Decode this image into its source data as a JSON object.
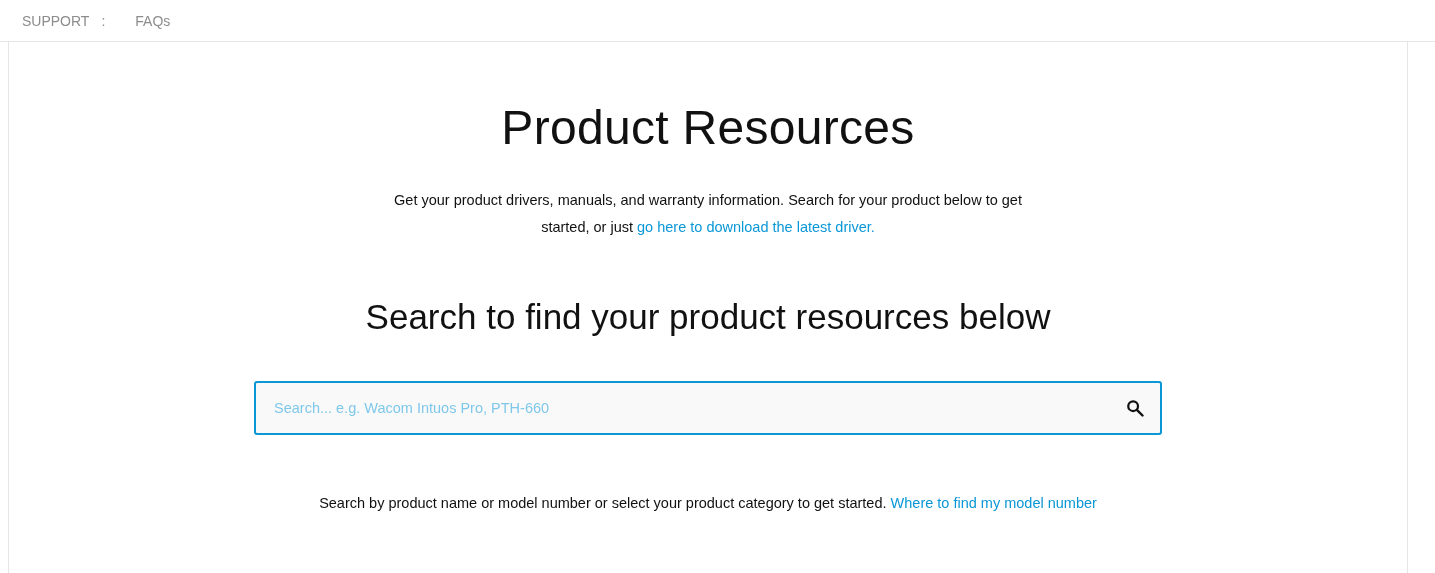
{
  "breadcrumb": [
    {
      "label": "SUPPORT",
      "kind": "link"
    },
    {
      "label": ":",
      "kind": "separator"
    },
    {
      "label": "FAQs",
      "kind": "link"
    }
  ],
  "title": "Product Resources",
  "intro": {
    "text": "Get your product drivers, manuals, and warranty information. Search for your product below to get started, or just ",
    "link": "go here to download the latest driver."
  },
  "search_heading": "Search to find your product resources below",
  "search": {
    "placeholder": "Search... e.g. Wacom Intuos Pro, PTH-660"
  },
  "hint": {
    "text": "Search by product name or model number or select your product category to get started. ",
    "link": "Where to find my model number"
  }
}
